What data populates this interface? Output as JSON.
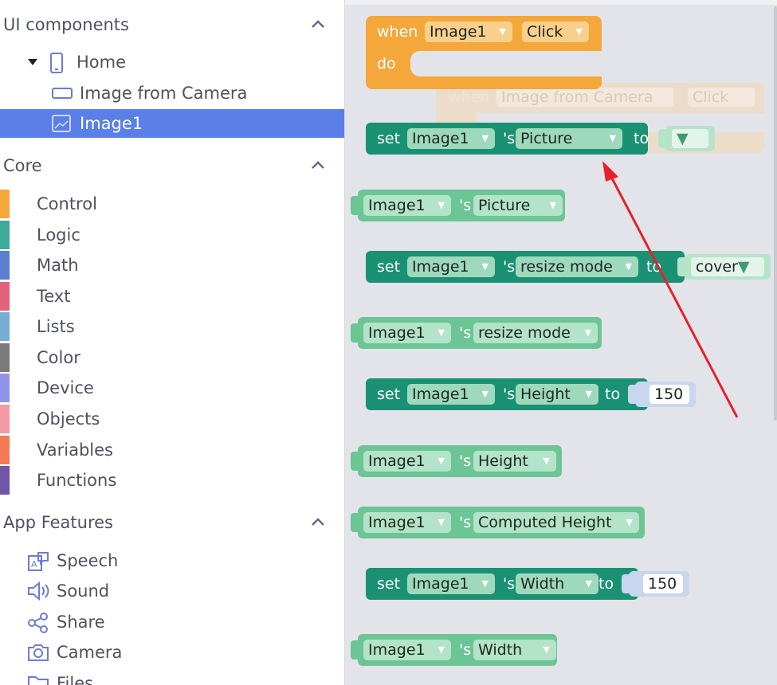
{
  "sidebar": {
    "ui_section": {
      "title": "UI components"
    },
    "tree": [
      {
        "label": "Home",
        "icon": "phone-icon"
      },
      {
        "label": "Image from Camera",
        "icon": "button-icon"
      },
      {
        "label": "Image1",
        "icon": "image-icon",
        "selected": true
      }
    ],
    "core_section": {
      "title": "Core"
    },
    "categories": [
      {
        "label": "Control",
        "color": "#f4a73a"
      },
      {
        "label": "Logic",
        "color": "#3fa99a"
      },
      {
        "label": "Math",
        "color": "#5c7fd1"
      },
      {
        "label": "Text",
        "color": "#e2627d"
      },
      {
        "label": "Lists",
        "color": "#76aed4"
      },
      {
        "label": "Color",
        "color": "#7a7a7a"
      },
      {
        "label": "Device",
        "color": "#8f94e8"
      },
      {
        "label": "Objects",
        "color": "#f39aa5"
      },
      {
        "label": "Variables",
        "color": "#f47a55"
      },
      {
        "label": "Functions",
        "color": "#6f56a6"
      }
    ],
    "features_section": {
      "title": "App Features"
    },
    "features": [
      {
        "label": "Speech",
        "icon": "speech-icon"
      },
      {
        "label": "Sound",
        "icon": "sound-icon"
      },
      {
        "label": "Share",
        "icon": "share-icon"
      },
      {
        "label": "Camera",
        "icon": "camera-icon"
      },
      {
        "label": "Files",
        "icon": "folder-icon"
      }
    ]
  },
  "workspace": {
    "event_block": {
      "when": "when",
      "component": "Image1",
      "event": "Click",
      "do": "do"
    },
    "ghost_block": {
      "when": "when",
      "component": "Image from Camera",
      "event": "Click"
    },
    "blocks": [
      {
        "kind": "set",
        "set": "set",
        "component": "Image1",
        "poss": "'s",
        "property": "Picture",
        "to": "to",
        "value": ""
      },
      {
        "kind": "get",
        "component": "Image1",
        "poss": "'s",
        "property": "Picture"
      },
      {
        "kind": "set",
        "set": "set",
        "component": "Image1",
        "poss": "'s",
        "property": "resize mode",
        "to": "to",
        "value": "cover"
      },
      {
        "kind": "get",
        "component": "Image1",
        "poss": "'s",
        "property": "resize mode"
      },
      {
        "kind": "set",
        "set": "set",
        "component": "Image1",
        "poss": "'s",
        "property": "Height",
        "to": "to",
        "value": "150"
      },
      {
        "kind": "get",
        "component": "Image1",
        "poss": "'s",
        "property": "Height"
      },
      {
        "kind": "get",
        "component": "Image1",
        "poss": "'s",
        "property": "Computed Height"
      },
      {
        "kind": "set",
        "set": "set",
        "component": "Image1",
        "poss": "'s",
        "property": "Width",
        "to": "to",
        "value": "150"
      },
      {
        "kind": "get",
        "component": "Image1",
        "poss": "'s",
        "property": "Width"
      }
    ],
    "annotation": {
      "type": "arrow",
      "color": "#e8202a"
    }
  }
}
